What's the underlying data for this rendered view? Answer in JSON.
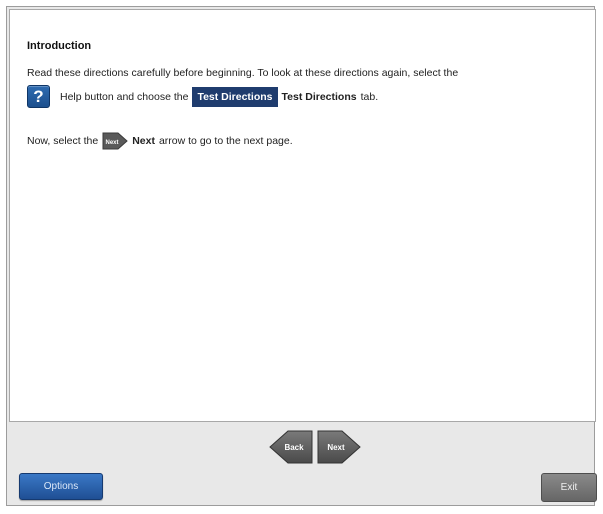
{
  "content": {
    "title": "Introduction",
    "line1": "Read these directions carefully before beginning. To look at these directions again, select the",
    "line2_after_icon": "Help button and choose the",
    "tab_chip": "Test Directions",
    "tab_bold": "Test Directions",
    "line2_tail": "tab.",
    "line3_prefix": "Now, select the",
    "next_inline_icon_text": "Next",
    "line3_bold": "Next",
    "line3_tail": "arrow to go to the next page.",
    "help_icon_glyph": "?"
  },
  "nav": {
    "back_label": "Back",
    "next_label": "Next"
  },
  "footer": {
    "options_label": "Options",
    "exit_label": "Exit"
  },
  "colors": {
    "accent_blue": "#1f3c6e",
    "help_blue": "#2f6cb1",
    "arrow_gray": "#5a5a5a"
  }
}
